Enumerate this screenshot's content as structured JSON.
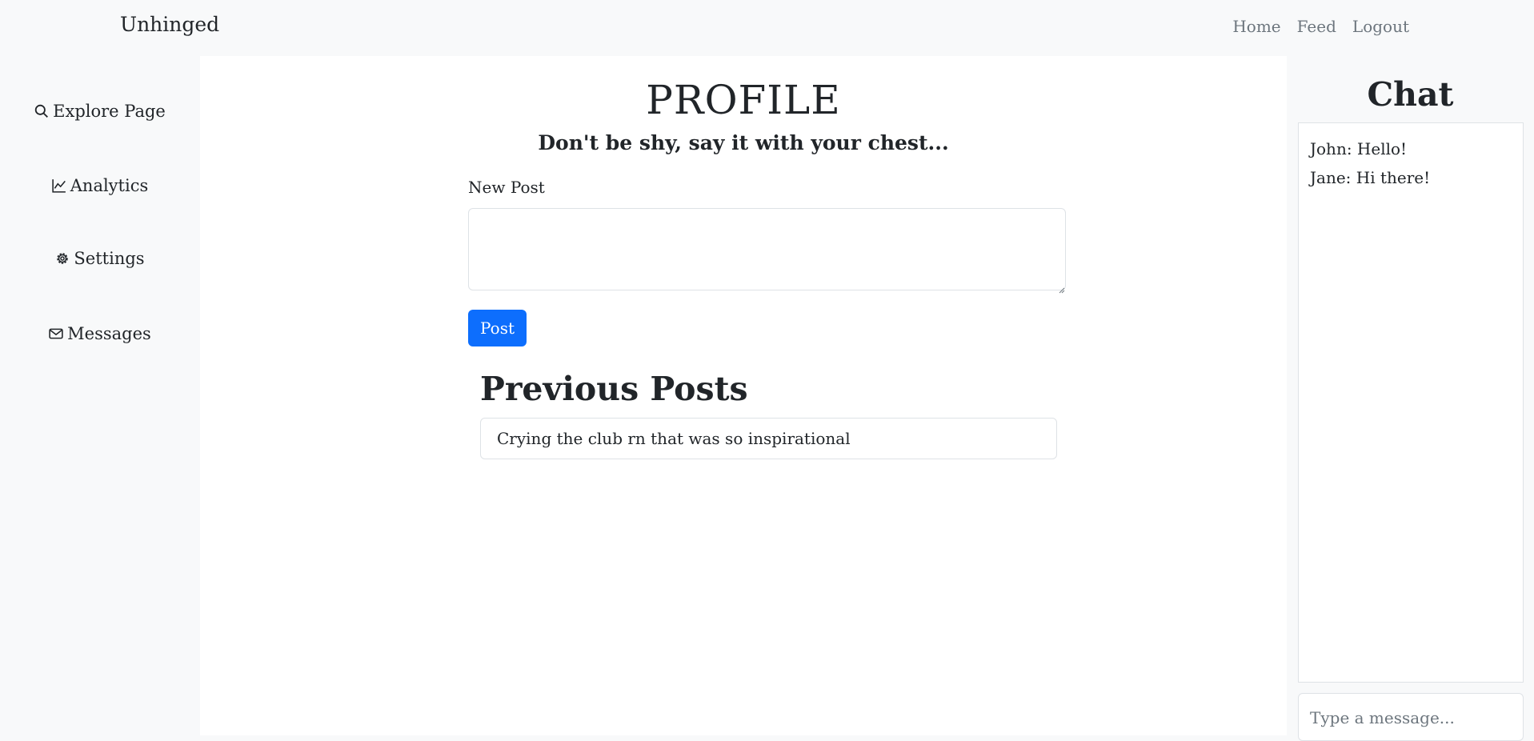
{
  "navbar": {
    "brand": "Unhinged",
    "links": [
      "Home",
      "Feed",
      "Logout"
    ]
  },
  "sidebar": {
    "items": [
      {
        "icon": "search-icon",
        "label": "Explore Page"
      },
      {
        "icon": "chart-line-icon",
        "label": "Analytics"
      },
      {
        "icon": "gear-icon",
        "label": "Settings"
      },
      {
        "icon": "envelope-icon",
        "label": "Messages"
      }
    ]
  },
  "main": {
    "title": "PROFILE",
    "subtitle": "Don't be shy, say it with your chest...",
    "new_post_label": "New Post",
    "new_post_value": "",
    "post_button": "Post",
    "previous_title": "Previous Posts",
    "posts": [
      "Crying the club rn that was so inspirational"
    ]
  },
  "chat": {
    "title": "Chat",
    "messages": [
      "John: Hello!",
      "Jane: Hi there!"
    ],
    "input_placeholder": "Type a message..."
  },
  "colors": {
    "accent": "#0d6efd",
    "page_bg": "#f8f9fa",
    "panel_bg": "#ffffff",
    "border": "#dee2e6",
    "muted_text": "#6c757d"
  }
}
